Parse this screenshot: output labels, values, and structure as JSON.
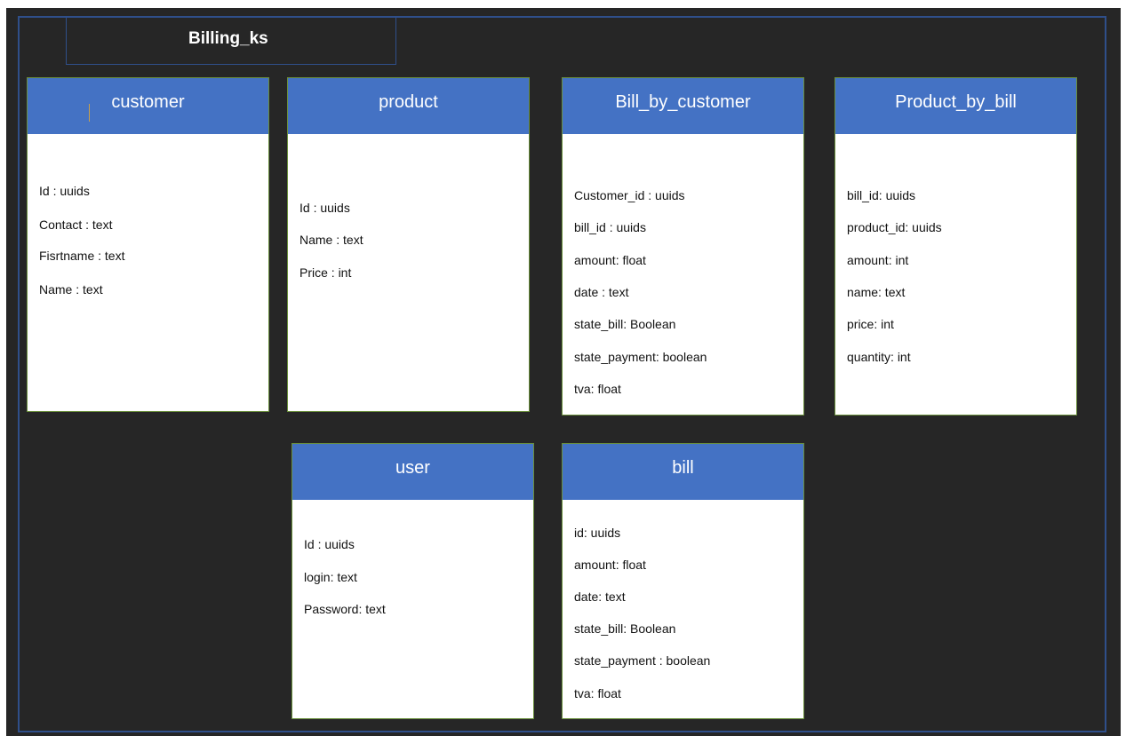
{
  "title": "Billing_ks",
  "tables": {
    "customer": {
      "name": "customer",
      "fields": [
        "Id : uuids",
        "Contact : text",
        "Fisrtname : text",
        "Name : text"
      ]
    },
    "product": {
      "name": "product",
      "fields": [
        "Id : uuids",
        "Name : text",
        "Price : int"
      ]
    },
    "bill_by_customer": {
      "name": "Bill_by_customer",
      "fields": [
        "Customer_id : uuids",
        "bill_id : uuids",
        "amount: float",
        "date : text",
        "state_bill: Boolean",
        "state_payment: boolean",
        "tva: float"
      ]
    },
    "product_by_bill": {
      "name": "Product_by_bill",
      "fields": [
        "bill_id: uuids",
        "product_id: uuids",
        "amount: int",
        "name: text",
        "price: int",
        "quantity: int"
      ]
    },
    "user": {
      "name": "user",
      "fields": [
        "Id : uuids",
        "login: text",
        "Password: text"
      ]
    },
    "bill": {
      "name": "bill",
      "fields": [
        "id: uuids",
        "amount: float",
        "date: text",
        "state_bill: Boolean",
        "state_payment : boolean",
        "tva: float"
      ]
    }
  },
  "colors": {
    "background": "#262626",
    "header": "#4472c4",
    "frame_border": "#2f4f8a",
    "table_border": "#6a8f3c"
  }
}
